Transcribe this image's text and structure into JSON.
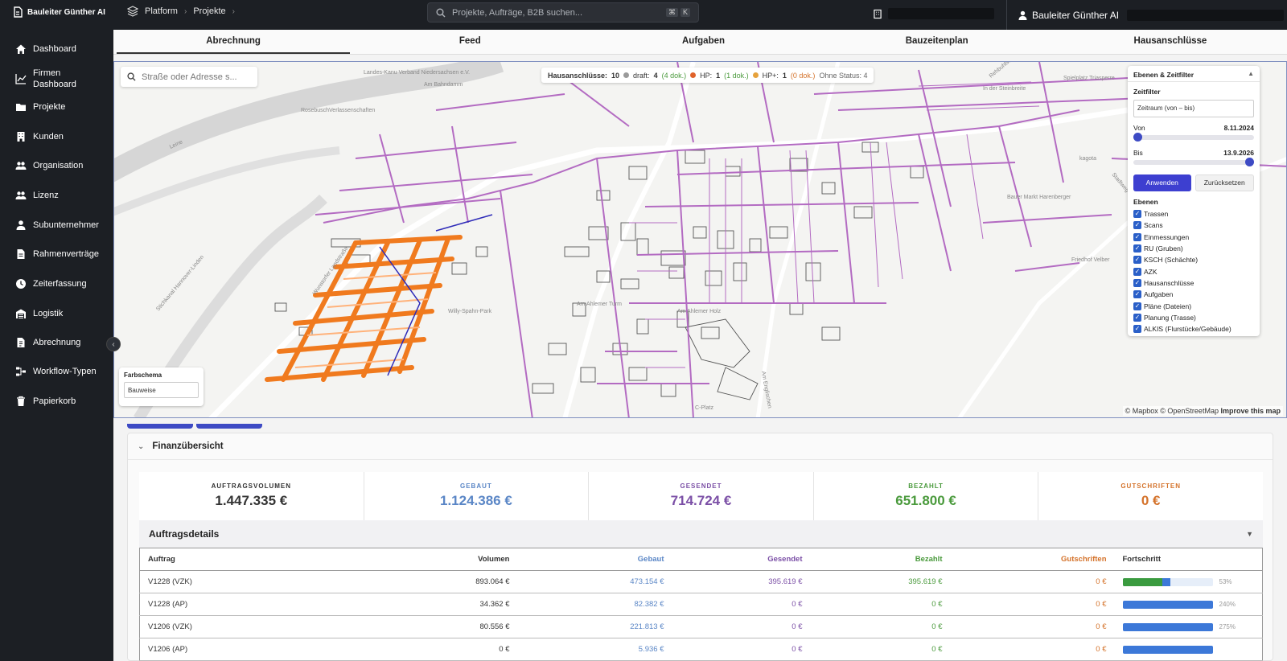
{
  "app": {
    "name": "Bauleiter Günther AI"
  },
  "breadcrumb": [
    "Platform",
    "Projekte"
  ],
  "search": {
    "placeholder": "Projekte, Aufträge, B2B suchen...",
    "kbd": [
      "⌘",
      "K"
    ]
  },
  "user": {
    "name": "Bauleiter Günther AI"
  },
  "sidebar": {
    "items": [
      {
        "label": "Dashboard",
        "icon": "home-icon"
      },
      {
        "label": "Firmen Dashboard",
        "icon": "chart-line-icon"
      },
      {
        "label": "Projekte",
        "icon": "folder-icon"
      },
      {
        "label": "Kunden",
        "icon": "building-icon"
      },
      {
        "label": "Organisation",
        "icon": "users-icon"
      },
      {
        "label": "Lizenz",
        "icon": "users-icon"
      },
      {
        "label": "Subunternehmer",
        "icon": "user-tie-icon"
      },
      {
        "label": "Rahmenverträge",
        "icon": "document-icon"
      },
      {
        "label": "Zeiterfassung",
        "icon": "clock-icon"
      },
      {
        "label": "Logistik",
        "icon": "warehouse-icon"
      },
      {
        "label": "Abrechnung",
        "icon": "invoice-icon"
      },
      {
        "label": "Workflow-Typen",
        "icon": "workflow-icon"
      },
      {
        "label": "Papierkorb",
        "icon": "trash-icon"
      }
    ]
  },
  "tabs": [
    "Abrechnung",
    "Feed",
    "Aufgaben",
    "Bauzeitenplan",
    "Hausanschlüsse"
  ],
  "map": {
    "search_placeholder": "Straße oder Adresse s...",
    "status": {
      "label": "Hausanschlüsse:",
      "total": "10",
      "draft_label": "draft:",
      "draft_count": "4",
      "draft_docs": "(4 dok.)",
      "hp_label": "HP:",
      "hp_count": "1",
      "hp_docs": "(1 dok.)",
      "hpplus_label": "HP+:",
      "hpplus_count": "1",
      "hpplus_docs": "(0 dok.)",
      "none_label": "Ohne Status: 4",
      "colors": {
        "draft": "#9a9a9a",
        "hp": "#e0622a",
        "hpplus": "#e6a23c"
      }
    },
    "color_scheme": {
      "label": "Farbschema",
      "value": "Bauweise"
    },
    "attribution": {
      "mapbox": "© Mapbox",
      "osm": "© OpenStreetMap",
      "improve": "Improve this map"
    },
    "place_labels": [
      "Landes-Kanu Verband Niedersachsen e.V.",
      "RosebuschVerlassenschaften",
      "Leine",
      "Am Bahndamm",
      "Stichkanal Hannover-Linden",
      "Wunstorfer Landstraße",
      "Willy-Spahn-Park",
      "Am Ahlemer Turm",
      "Am Ahlemer Holz",
      "Am Englischen",
      "C-Platz",
      "In der Steinbreite",
      "Friedhof Velber",
      "Spielplatz Triasperre",
      "Rehbuhlstraße",
      "Bauer Markt Harenberger",
      "kagota",
      "Stadtweg"
    ]
  },
  "layers": {
    "title": "Ebenen & Zeitfilter",
    "time_filter_label": "Zeitfilter",
    "range_placeholder": "Zeitraum (von – bis)",
    "from_label": "Von",
    "from_value": "8.11.2024",
    "to_label": "Bis",
    "to_value": "13.9.2026",
    "from_fraction": 0.0,
    "to_fraction": 1.0,
    "apply_label": "Anwenden",
    "reset_label": "Zurücksetzen",
    "layers_label": "Ebenen",
    "items": [
      "Trassen",
      "Scans",
      "Einmessungen",
      "RU (Gruben)",
      "KSCH (Schächte)",
      "AZK",
      "Hausanschlüsse",
      "Aufgaben",
      "Pläne (Dateien)",
      "Planung (Trasse)",
      "ALKIS (Flurstücke/Gebäude)"
    ]
  },
  "finance": {
    "title": "Finanzübersicht",
    "kpis": [
      {
        "label": "AUFTRAGSVOLUMEN",
        "value": "1.447.335 €",
        "color": "#333333"
      },
      {
        "label": "GEBAUT",
        "value": "1.124.386 €",
        "color": "#5a86c6"
      },
      {
        "label": "GESENDET",
        "value": "714.724 €",
        "color": "#7b4fa6"
      },
      {
        "label": "BEZAHLT",
        "value": "651.800 €",
        "color": "#4a9a3c"
      },
      {
        "label": "GUTSCHRIFTEN",
        "value": "0 €",
        "color": "#d4722a"
      }
    ],
    "details_title": "Auftragsdetails",
    "columns": [
      "Auftrag",
      "Volumen",
      "Gebaut",
      "Gesendet",
      "Bezahlt",
      "Gutschriften",
      "Fortschritt"
    ],
    "rows": [
      {
        "order": "V1228 (VZK)",
        "volume": "893.064 €",
        "built": "473.154 €",
        "sent": "395.619 €",
        "paid": "395.619 €",
        "credits": "0 €",
        "progress": "53%",
        "progress_value": 0.53,
        "paid_value": 0.44
      },
      {
        "order": "V1228 (AP)",
        "volume": "34.362 €",
        "built": "82.382 €",
        "sent": "0 €",
        "paid": "0 €",
        "credits": "0 €",
        "progress": "240%",
        "progress_value": 1.0,
        "paid_value": 0
      },
      {
        "order": "V1206 (VZK)",
        "volume": "80.556 €",
        "built": "221.813 €",
        "sent": "0 €",
        "paid": "0 €",
        "credits": "0 €",
        "progress": "275%",
        "progress_value": 1.0,
        "paid_value": 0
      },
      {
        "order": "V1206 (AP)",
        "volume": "0 €",
        "built": "5.936 €",
        "sent": "0 €",
        "paid": "0 €",
        "credits": "0 €",
        "progress": "",
        "progress_value": 1.0,
        "paid_value": 0
      }
    ]
  }
}
